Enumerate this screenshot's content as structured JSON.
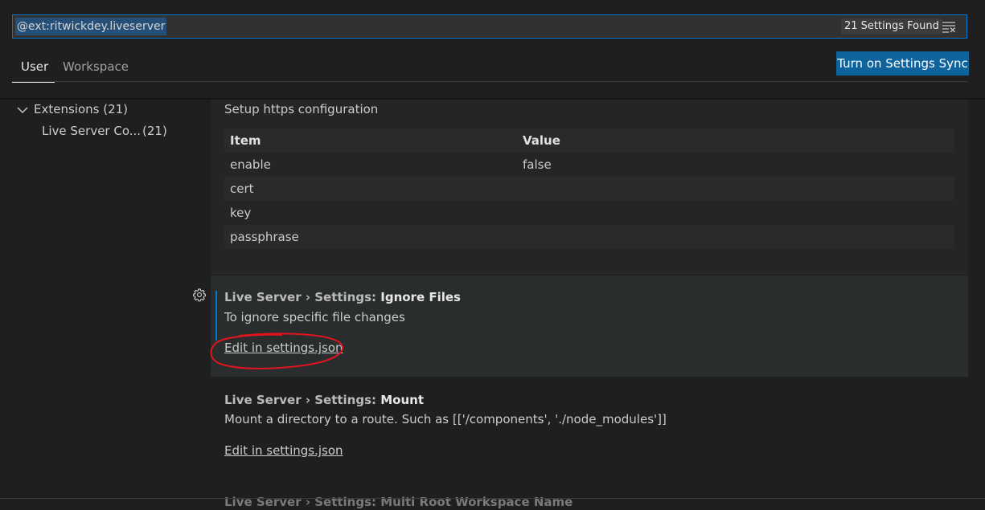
{
  "search": {
    "value": "@ext:ritwickdey.liveserver",
    "results_count": "21 Settings Found",
    "filter_icon": "clear-filter-icon"
  },
  "tabs": [
    {
      "label": "User",
      "active": true
    },
    {
      "label": "Workspace",
      "active": false
    }
  ],
  "sync_button_label": "Turn on Settings Sync",
  "tree": {
    "extensions": {
      "label": "Extensions",
      "count": "(21)",
      "icon": "chevron-down-icon"
    },
    "live_server": {
      "label": "Live Server Co...",
      "count": "(21)"
    }
  },
  "https_setting": {
    "description": "Setup https configuration",
    "table": {
      "headers": [
        "Item",
        "Value"
      ],
      "rows": [
        [
          "enable",
          "false"
        ],
        [
          "cert",
          ""
        ],
        [
          "key",
          ""
        ],
        [
          "passphrase",
          ""
        ]
      ]
    }
  },
  "ignore_files_setting": {
    "category": "Live Server › Settings: ",
    "name": "Ignore Files",
    "description": "To ignore specific file changes",
    "link": "Edit in settings.json",
    "gear_icon": "gear-icon"
  },
  "mount_setting": {
    "category": "Live Server › Settings: ",
    "name": "Mount",
    "description": "Mount a directory to a route. Such as [['/components', './node_modules']]",
    "link": "Edit in settings.json"
  },
  "cutoff_setting_title": "Live Server › Settings: Multi Root Workspace Name",
  "colors": {
    "accent": "#0078d4",
    "button": "#0e639c",
    "annotation": "#e0141e"
  }
}
